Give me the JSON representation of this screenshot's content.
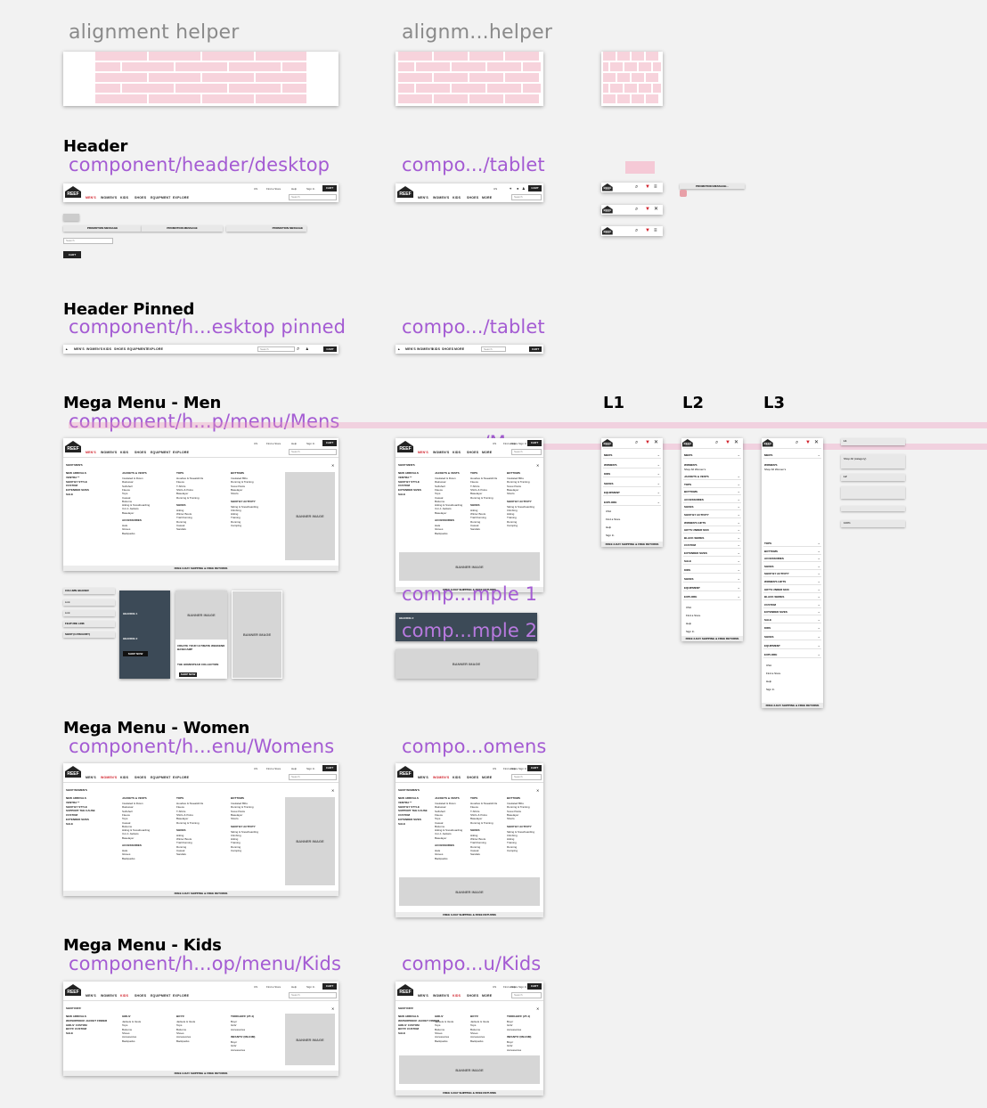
{
  "alignment": {
    "title_desktop": "alignment helper",
    "title_tablet": "alignm...helper"
  },
  "header": {
    "title": "Header",
    "desktop_path": "component/header/desktop",
    "tablet_path": "compo.../tablet",
    "logo": "REEF",
    "nav": [
      "MEN'S",
      "WOMEN'S",
      "KIDS",
      "SHOES",
      "EQUIPMENT",
      "EXPLORE"
    ],
    "tablet_nav": [
      "MEN'S",
      "WOMEN'S",
      "KIDS",
      "SHOES",
      "MORE"
    ],
    "util": [
      "US",
      "Find a Store",
      "Help",
      "Sign In"
    ],
    "cart": "CART",
    "search_placeholder": "Search",
    "promo": "PROMOTION MESSAGE",
    "promo_short": "PROMOTION MESSAGE..."
  },
  "pinned": {
    "title": "Header Pinned",
    "desktop_path": "component/h...esktop pinned",
    "tablet_path": "compo.../tablet"
  },
  "men": {
    "title": "Mega Menu - Men",
    "desktop_path": "component/h...p/menu/Mens",
    "tablet_path": "compo.../Mens",
    "shop_label": "SHOP MEN'S",
    "left_links": [
      "NEW ARRIVALS",
      "VENTRA™",
      "SHOP BY STYLE",
      "CUSTOM",
      "EXTENDED SIZES",
      "SALE"
    ],
    "col1_title": "JACKETS & VESTS",
    "col1_items": [
      "Insulated & Down",
      "Rainwear",
      "Softshell",
      "Fleece",
      "Tops",
      "Casual",
      "Bottoms",
      "Hiking & Snowboarding",
      "3-in-1 Jackets",
      "Baselayer"
    ],
    "col1b_title": "ACCESSORIES",
    "col1b_items": [
      "Hats",
      "Gloves",
      "Backpacks"
    ],
    "col2_title": "TOPS",
    "col2_items": [
      "Hoodies & Sweatshirts",
      "Fleece",
      "T-Shirts",
      "Shirts & Polos",
      "Baselayer",
      "Running & Training"
    ],
    "col2b_title": "SHOES",
    "col2b_items": [
      "Hiking",
      "Winter Boots",
      "Trail Running",
      "Running",
      "Casual",
      "Sandals"
    ],
    "col3_title": "BOTTOMS",
    "col3_items": [
      "Insulated Bibs",
      "Running & Training",
      "Snow Pants",
      "Baselayer",
      "Shorts"
    ],
    "col3b_title": "SHOP BY ACTIVITY",
    "col3b_items": [
      "Skiing & Snowboarding",
      "Climbing",
      "Hiking",
      "Training",
      "Running",
      "Camping"
    ],
    "banner": "BANNER IMAGE",
    "footer": "FREE 3-DAY SHIPPING & FREE RETURNS",
    "example1": "comp...mple 1",
    "example2": "comp...mple 2",
    "sample_links": [
      "COLUMN HEADER",
      "Link",
      "Link",
      "FEATURE LINK",
      "SHOP (CATEGORY)"
    ],
    "heading1": "HEADING 1",
    "heading2": "HEADING 2",
    "shop_now": "SHOP NOW",
    "create_text": "CREATE YOUR ULTIMATE WEEKEND BASECAMP",
    "collection": "THE HOMESTEAD COLLECTION"
  },
  "levels": {
    "l1": "L1",
    "l2": "L2",
    "l3": "L3",
    "l1_items": [
      "MEN'S",
      "WOMEN'S",
      "KIDS",
      "SHOES",
      "EQUIPMENT",
      "EXPLORE"
    ],
    "util_items": [
      "USA",
      "Find a Store",
      "Help",
      "Sign In"
    ],
    "l2_items": [
      "JACKETS & VESTS",
      "TOPS",
      "BOTTOMS",
      "ACCESSORIES",
      "SHOES",
      "SHOP BY ACTIVITY",
      "WOMEN'S GIFTS",
      "GIFTS UNDER $100",
      "BLACK SERIES",
      "CUSTOM",
      "EXTENDED SIZES",
      "SALE"
    ],
    "shop_all": "Shop All Women's",
    "footer": "FREE 3-DAY SHIPPING & FREE RETURNS",
    "side_labels": [
      "L1",
      "Shop All (category)",
      "L2",
      "100%"
    ]
  },
  "women": {
    "title": "Mega Menu - Women",
    "desktop_path": "component/h...enu/Womens",
    "tablet_path": "compo...omens",
    "shop_label": "SHOP WOMEN'S",
    "left_links": [
      "NEW ARRIVALS",
      "VENTRA™",
      "SHOP BY STYLE",
      "SUPPORT THE CAUSE",
      "CUSTOM",
      "EXTENDED SIZES",
      "SALE"
    ]
  },
  "kids": {
    "title": "Mega Menu - Kids",
    "desktop_path": "component/h...op/menu/Kids",
    "tablet_path": "compo...u/Kids",
    "shop_label": "SHOP KIDS'",
    "left_links": [
      "NEW ARRIVALS",
      "WATERPROOF JACKET FINDER",
      "GIRLS' CUSTOM",
      "BOYS' CUSTOM",
      "SALE"
    ],
    "col1_title": "GIRLS'",
    "col1_items": [
      "Jackets & Vests",
      "Tops",
      "Bottoms",
      "Shoes",
      "Accessories",
      "Backpacks"
    ],
    "col2_title": "BOYS'",
    "col2_items": [
      "Jackets & Vests",
      "Tops",
      "Bottoms",
      "Shoes",
      "Accessories",
      "Backpacks"
    ],
    "col3_title": "TODDLERS' (2T-4)",
    "col3_items": [
      "Boys'",
      "Girls'",
      "Accessories"
    ],
    "col3b_title": "INFANTS' (0M-24M)",
    "col3b_items": [
      "Boys'",
      "Girls'",
      "Accessories"
    ]
  }
}
